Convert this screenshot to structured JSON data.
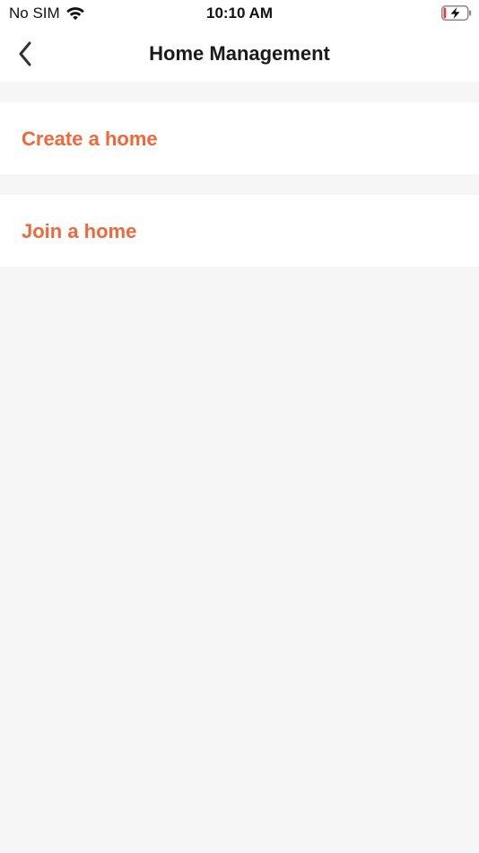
{
  "status_bar": {
    "carrier": "No SIM",
    "time": "10:10 AM",
    "wifi_icon": "wifi-icon",
    "battery_icon": "battery-charging-icon"
  },
  "nav": {
    "back_icon": "chevron-left-icon",
    "title": "Home Management"
  },
  "options": [
    {
      "label": "Create a home"
    },
    {
      "label": "Join a home"
    }
  ],
  "colors": {
    "accent": "#f0673a",
    "background": "#f6f6f6",
    "surface": "#ffffff",
    "title_text": "#1a1a1a",
    "battery_low": "#e0413a"
  }
}
